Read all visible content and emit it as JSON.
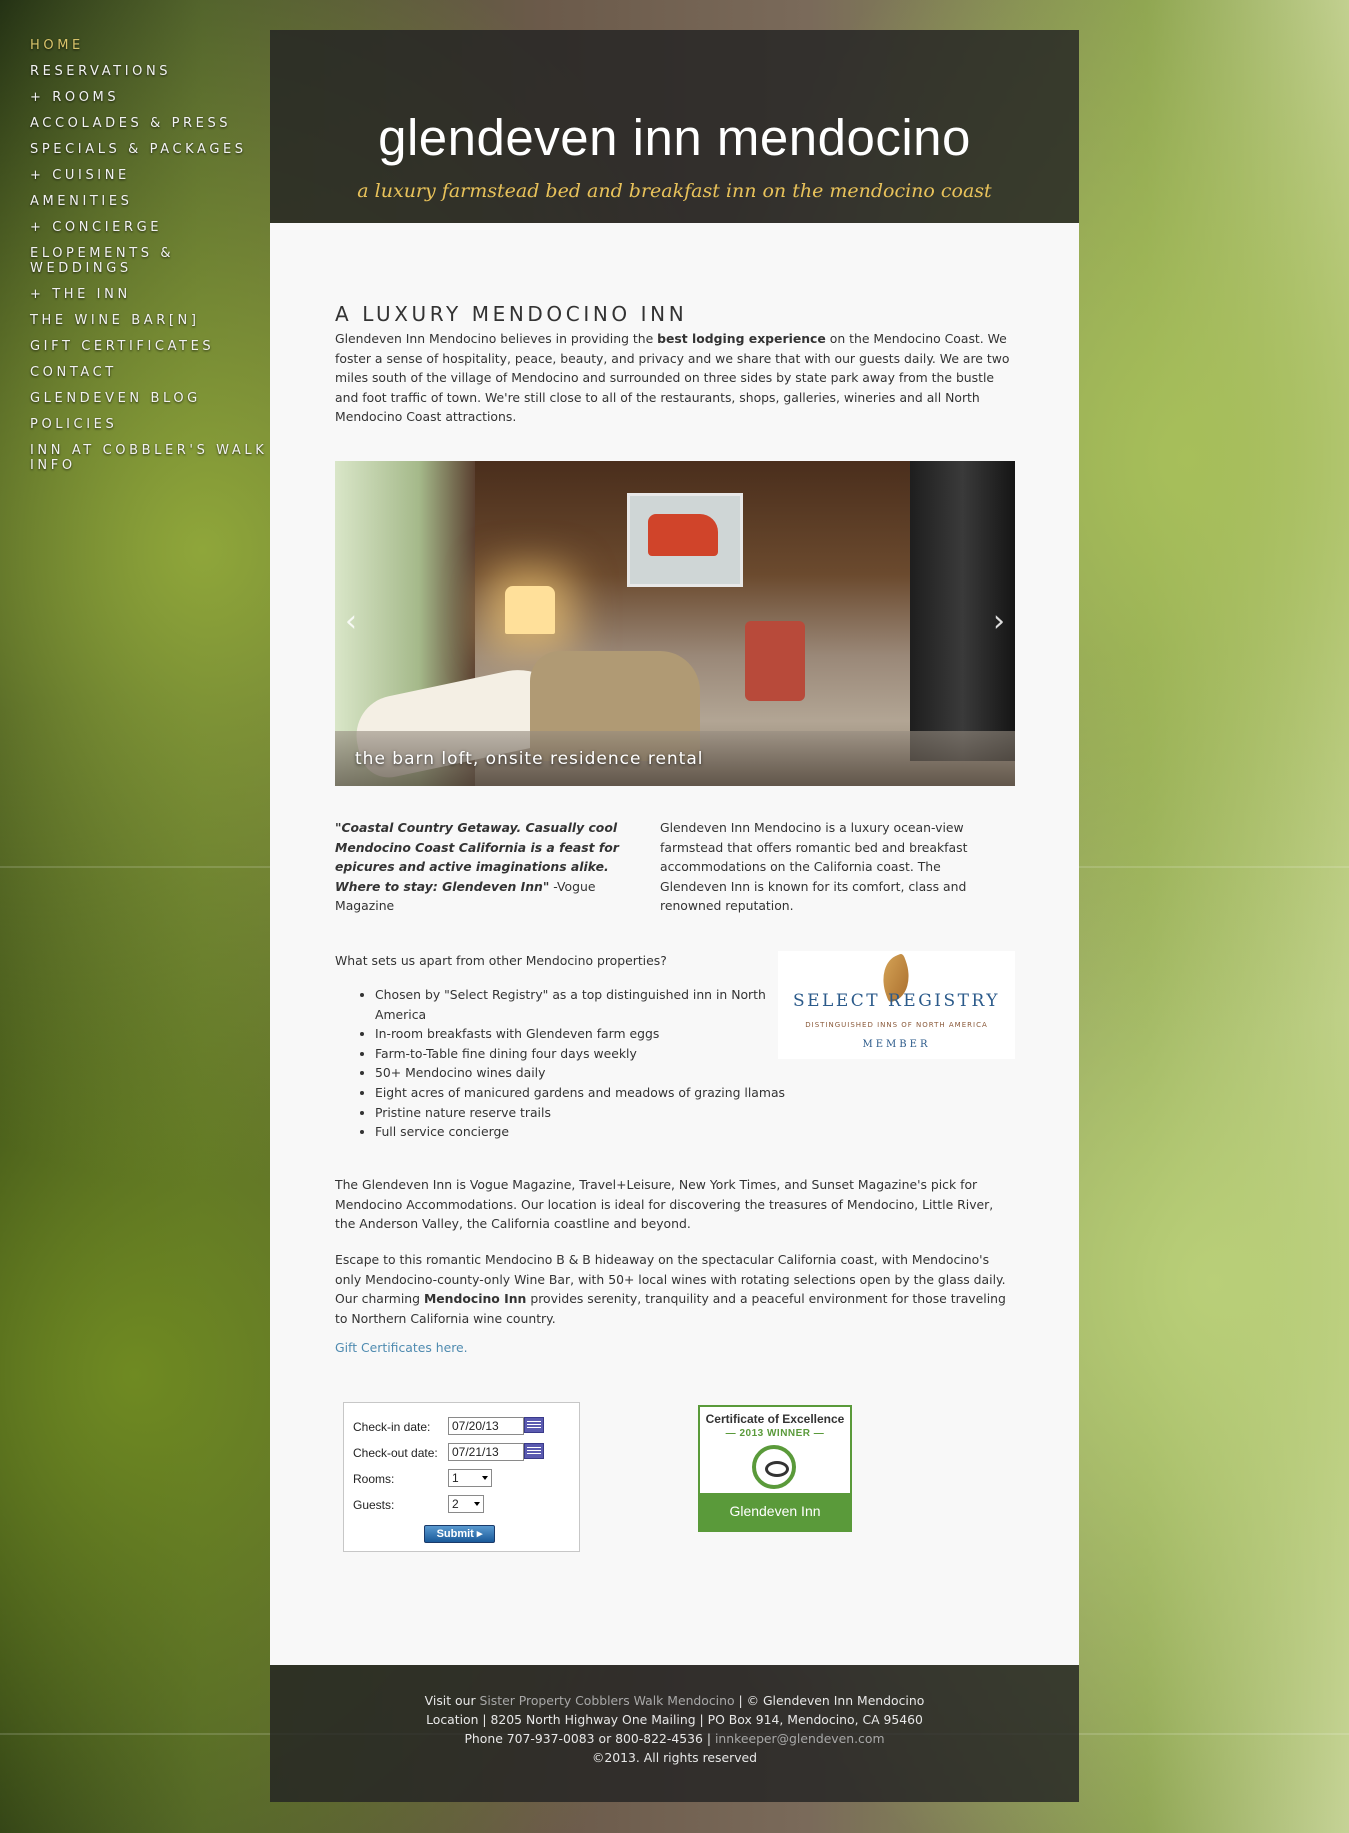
{
  "nav": {
    "items": [
      {
        "label": "Home"
      },
      {
        "label": "Reservations"
      },
      {
        "label": "+ Rooms"
      },
      {
        "label": "Accolades & Press"
      },
      {
        "label": "Specials & Packages"
      },
      {
        "label": "+ Cuisine"
      },
      {
        "label": "Amenities"
      },
      {
        "label": "+ Concierge"
      },
      {
        "label": "Elopements & Weddings"
      },
      {
        "label": "+ The Inn"
      },
      {
        "label": "The Wine Bar[n]"
      },
      {
        "label": "Gift Certificates"
      },
      {
        "label": "Contact"
      },
      {
        "label": "Glendeven Blog"
      },
      {
        "label": "Policies"
      },
      {
        "label": "Inn at Cobbler's Walk Info"
      }
    ],
    "active_color": "#d8c36a"
  },
  "header": {
    "title": "glendeven inn mendocino",
    "tagline": "a luxury farmstead bed and breakfast inn on the mendocino coast"
  },
  "main": {
    "heading": "A LUXURY MENDOCINO INN",
    "intro_a": "Glendeven Inn Mendocino believes in providing the ",
    "intro_bold": "best lodging experience",
    "intro_b": " on the Mendocino Coast.  We foster a sense of hospitality, peace, beauty, and privacy and we share that with our guests daily.  We are two miles south of the village of Mendocino and surrounded on three sides by state park away from the bustle and foot traffic of town.  We're still close to all of the restaurants, shops, galleries, wineries and all North Mendocino Coast attractions.",
    "slideshow": {
      "caption": "the barn loft, onsite residence rental",
      "prev_arrow": "‹",
      "next_arrow": "›"
    },
    "quote_text": "\"Coastal Country Getaway. Casually cool Mendocino Coast California is a feast for epicures and active imaginations alike. Where to stay: Glendeven Inn\"",
    "quote_source": "   -Vogue Magazine",
    "description": "Glendeven Inn Mendocino is a luxury ocean-view farmstead that offers romantic bed and breakfast accommodations on the California coast. The Glendeven Inn is known for its comfort, class and renowned reputation.",
    "apart_title": "What sets us apart from other Mendocino properties?",
    "features": [
      "Chosen by \"Select Registry\" as a top distinguished inn in North America",
      "In-room breakfasts with Glendeven farm eggs",
      "Farm-to-Table fine dining four days weekly",
      "50+ Mendocino wines daily",
      "Eight acres of manicured gardens and meadows of grazing llamas",
      "Pristine nature reserve trails",
      "Full service concierge"
    ],
    "registry": {
      "name": "SELECT REGISTRY",
      "sub": "DISTINGUISHED INNS OF NORTH AMERICA",
      "member": "MEMBER"
    },
    "para2": "The Glendeven Inn is Vogue Magazine, Travel+Leisure, New York Times, and Sunset Magazine's pick for Mendocino Accommodations. Our location is ideal for discovering the treasures of Mendocino, Little River, the Anderson Valley, the California coastline and beyond.",
    "para3_a": "Escape to this romantic Mendocino B & B hideaway on the spectacular California coast, with Mendocino's only Mendocino-county-only Wine Bar, with 50+ local wines with rotating selections open by the glass daily. Our charming ",
    "para3_bold": "Mendocino Inn",
    "para3_b": " provides serenity, tranquility and a peaceful environment for those traveling to Northern California wine country.",
    "gift_link": "Gift Certificates here."
  },
  "booking": {
    "checkin_label": "Check-in date:",
    "checkin_value": "07/20/13",
    "checkout_label": "Check-out date:",
    "checkout_value": "07/21/13",
    "rooms_label": "Rooms:",
    "rooms_value": "1",
    "guests_label": "Guests:",
    "guests_value": "2",
    "submit_label": "Submit ▸"
  },
  "certificate": {
    "title": "Certificate of Excellence",
    "year": "— 2013 WINNER —",
    "name": "Glendeven Inn"
  },
  "footer": {
    "visit_prefix": "Visit our ",
    "sister_link": "Sister Property Cobblers Walk Mendocino",
    "copyright_inline": "  |  © Glendeven Inn Mendocino",
    "location": "Location | 8205 North Highway One      Mailing | PO Box 914, Mendocino, CA 95460",
    "phone": "Phone 707-937-0083  or  800-822-4536  |  ",
    "email": "innkeeper@glendeven.com",
    "rights": "©2013. All rights reserved"
  },
  "colors": {
    "accent_gold": "#e8c25a",
    "link_blue": "#4f8bb0",
    "tripadvisor_green": "#5a9a3a"
  }
}
